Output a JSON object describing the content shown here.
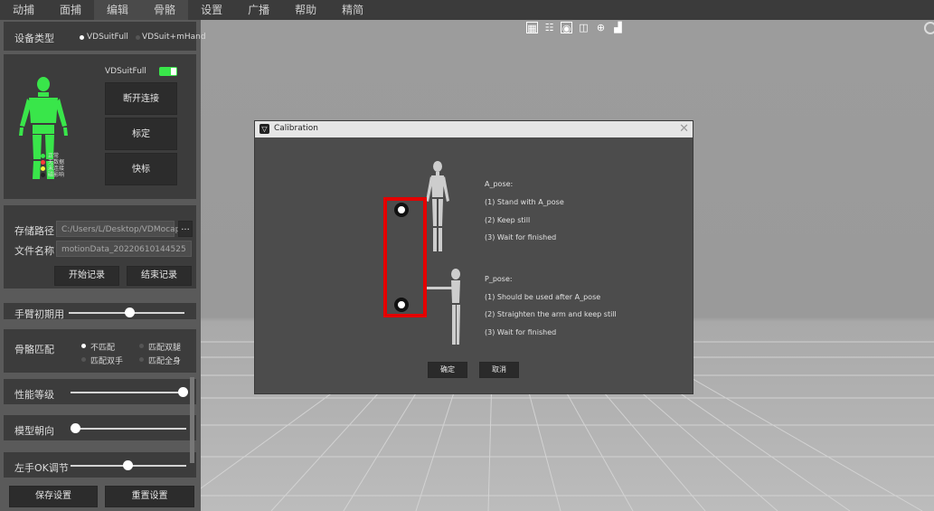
{
  "menu": [
    "动捕",
    "面捕",
    "编辑",
    "骨骼",
    "设置",
    "广播",
    "帮助",
    "精简"
  ],
  "toolbar_icons": [
    "grid-icon",
    "bone-icon",
    "camera-icon",
    "frame-icon",
    "target-icon",
    "floor-icon"
  ],
  "left_panel": {
    "device_type_label": "设备类型",
    "device_options": [
      "VDSuitFull",
      "VDSuit+mHand"
    ],
    "device_toggle_label": "VDSuitFull",
    "disconnect_button": "断开连接",
    "calibrate_button": "标定",
    "quick_calibrate_button": "快标",
    "legend": [
      "正常",
      "无数据",
      "未连接",
      "磁影响"
    ],
    "legend_colors": [
      "#39e64a",
      "#ff3b3b",
      "#f7f23a",
      "#2c2c2c"
    ],
    "save_path_label": "存储路径",
    "save_path_value": "C:/Users/L/Desktop/VDMocapS",
    "browse_button": "...",
    "file_name_label": "文件名称",
    "file_name_value": "motionData_20220610144525",
    "start_record_button": "开始记录",
    "stop_record_button": "结束记录",
    "cut_label": "手臂初期用",
    "bone_match_label": "骨骼匹配",
    "bone_match_options": [
      "不匹配",
      "匹配双腿",
      "匹配双手",
      "匹配全身"
    ],
    "performance_label": "性能等级",
    "model_orient_label": "模型朝向",
    "left_hand_ok_label": "左手OK调节",
    "save_settings_button": "保存设置",
    "reset_settings_button": "重置设置"
  },
  "dialog": {
    "title": "Calibration",
    "a_pose_title": "A_pose:",
    "a_pose_steps": [
      "(1) Stand with A_pose",
      "(2) Keep still",
      "(3) Wait for finished"
    ],
    "p_pose_title": "P_pose:",
    "p_pose_steps": [
      "(1) Should be used after A_pose",
      "(2) Straighten the arm and keep still",
      "(3) Wait for finished"
    ],
    "confirm_button": "确定",
    "cancel_button": "取消"
  }
}
